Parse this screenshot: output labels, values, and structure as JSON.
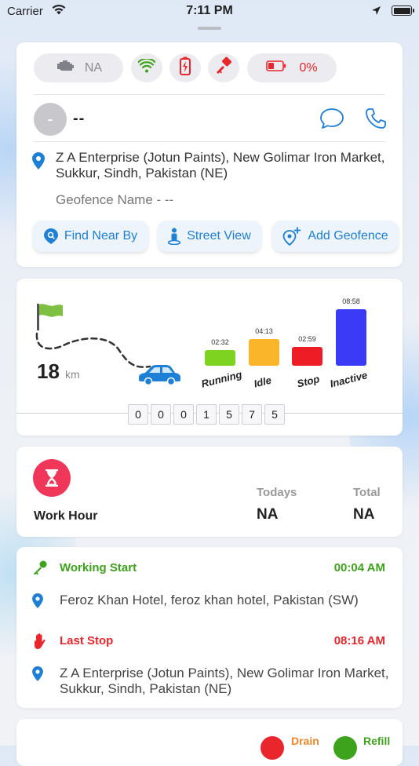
{
  "status_bar": {
    "carrier": "Carrier",
    "time": "7:11 PM"
  },
  "vehicle_status": {
    "engine_value": "NA",
    "battery_value": "0%"
  },
  "driver": {
    "initial": "-",
    "name": "--"
  },
  "location": {
    "address": "Z A Enterprise (Jotun Paints), New Golimar Iron Market, Sukkur, Sindh, Pakistan (NE)",
    "geofence_name": "Geofence Name - --"
  },
  "actions": {
    "find_near_by": "Find Near By",
    "street_view": "Street View",
    "add_geofence": "Add Geofence"
  },
  "trip": {
    "distance": "18",
    "distance_unit": "km",
    "odometer": [
      "0",
      "0",
      "0",
      "1",
      "5",
      "7",
      "5"
    ]
  },
  "chart_data": {
    "type": "bar",
    "categories": [
      "Running",
      "Idle",
      "Stop",
      "Inactive"
    ],
    "values": [
      "02:32",
      "04:13",
      "02:59",
      "08:58"
    ],
    "minutes": [
      152,
      253,
      179,
      538
    ],
    "colors": [
      "#7ed321",
      "#fbb52a",
      "#ee1c25",
      "#3b3bf7"
    ]
  },
  "work_hour": {
    "label": "Work Hour",
    "todays_label": "Todays",
    "total_label": "Total",
    "todays_value": "NA",
    "total_value": "NA"
  },
  "activity": {
    "start_title": "Working Start",
    "start_time": "00:04 AM",
    "start_address": "Feroz Khan Hotel, feroz khan hotel, Pakistan (SW)",
    "stop_title": "Last Stop",
    "stop_time": "08:16 AM",
    "stop_address": "Z A Enterprise (Jotun Paints), New Golimar Iron Market, Sukkur, Sindh, Pakistan (NE)"
  },
  "fuel": {
    "drain_label": "Drain",
    "refill_label": "Refill"
  },
  "colors": {
    "accent_blue": "#1e7fd6",
    "green": "#3ea31c",
    "red": "#e8262b",
    "pink": "#f0375a"
  }
}
